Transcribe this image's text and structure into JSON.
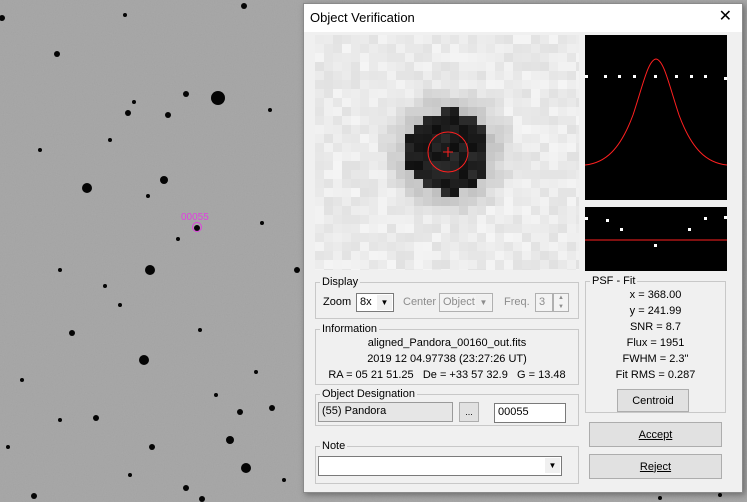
{
  "target_label": "00055",
  "dialog": {
    "title": "Object Verification",
    "close_icon": "close-icon"
  },
  "display": {
    "legend": "Display",
    "zoom_label": "Zoom",
    "zoom_value": "8x",
    "center_label": "Center",
    "center_value": "Object",
    "freq_label": "Freq.",
    "freq_value": "3"
  },
  "information": {
    "legend": "Information",
    "filename": "aligned_Pandora_00160_out.fits",
    "datetime": "2019 12 04.97738 (23:27:26 UT)",
    "coords": "RA = 05 21 51.25   De = +33 57 32.9   G = 13.48"
  },
  "designation": {
    "legend": "Object Designation",
    "name": "(55) Pandora",
    "browse_label": "...",
    "code": "00055"
  },
  "note": {
    "legend": "Note",
    "value": ""
  },
  "psf": {
    "legend": "PSF - Fit",
    "x": "x = 368.00",
    "y": "y = 241.99",
    "snr": "SNR = 8.7",
    "flux": "Flux = 1951",
    "fwhm": "FWHM = 2.3\"",
    "fitrms": "Fit RMS = 0.287",
    "centroid_label": "Centroid"
  },
  "buttons": {
    "accept": "Accept",
    "reject": "Reject"
  },
  "colors": {
    "fit_curve": "#ff2020",
    "target_marker": "#e040e0"
  }
}
